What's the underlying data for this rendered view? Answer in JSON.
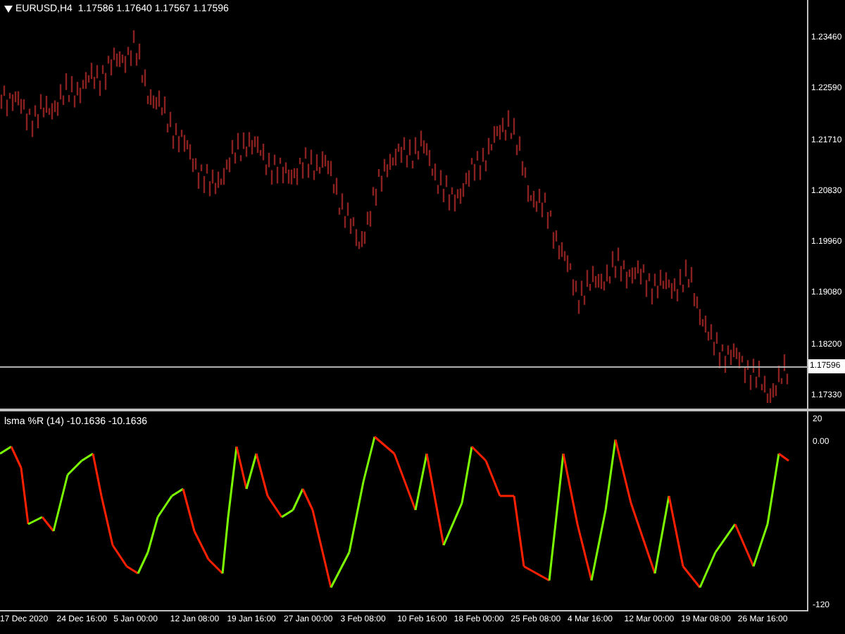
{
  "price_panel": {
    "header": "EURUSD,H4  1.17586 1.17640 1.17567 1.17596",
    "price_axis": [
      "1.23460",
      "1.22590",
      "1.21710",
      "1.20830",
      "1.19960",
      "1.19080",
      "1.18200",
      "1.17330"
    ],
    "current_price": "1.17596"
  },
  "indicator_panel": {
    "header": "lsma %R (14) -10.1636 -10.1636",
    "axis": [
      "20",
      "0.00",
      "-120"
    ]
  },
  "time_axis": [
    "17 Dec 2020",
    "24 Dec 16:00",
    "5 Jan 00:00",
    "12 Jan 08:00",
    "19 Jan 16:00",
    "27 Jan 00:00",
    "3 Feb 08:00",
    "10 Feb 16:00",
    "18 Feb 00:00",
    "25 Feb 08:00",
    "4 Mar 16:00",
    "12 Mar 00:00",
    "19 Mar 08:00",
    "26 Mar 16:00"
  ]
}
